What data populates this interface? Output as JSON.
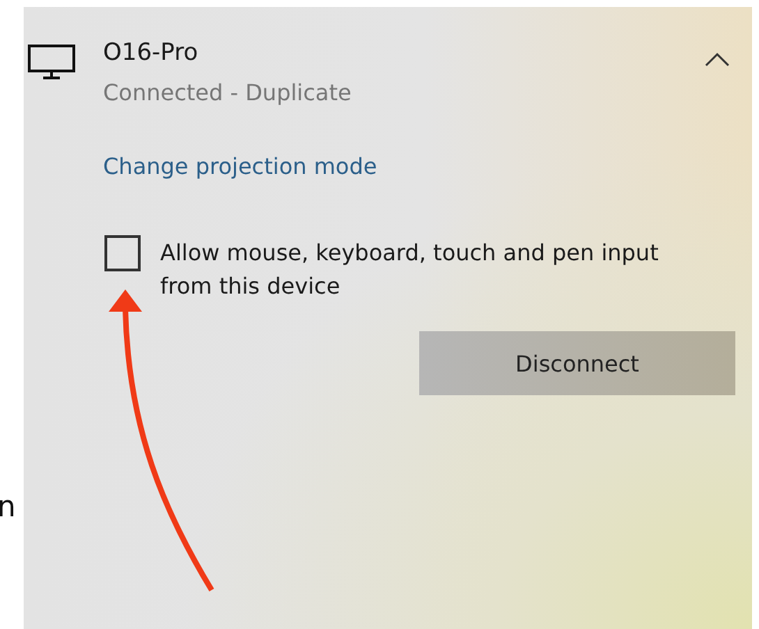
{
  "side_text": "n",
  "device": {
    "name": "O16-Pro",
    "status": "Connected - Duplicate",
    "expanded": true
  },
  "link": "Change projection mode",
  "checkbox": {
    "label": "Allow mouse, keyboard, touch and pen input from this device",
    "checked": false
  },
  "button": "Disconnect"
}
